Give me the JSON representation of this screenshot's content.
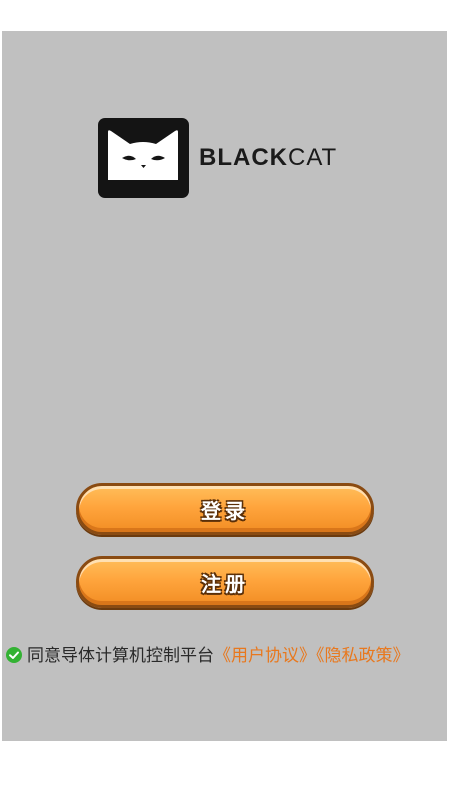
{
  "brand": {
    "logo_alt": "black-cat-logo",
    "name_bold": "BLACK",
    "name_regular": "CAT"
  },
  "buttons": {
    "login_label": "登录",
    "register_label": "注册"
  },
  "agreement": {
    "text": "同意导体计算机控制平台",
    "user_agreement": "《用户协议》",
    "privacy_policy": "《隐私政策》",
    "checked": true
  },
  "colors": {
    "panel": "#c0c0c0",
    "button": "#ffa53d",
    "link": "#e8781e",
    "check": "#33b233"
  }
}
